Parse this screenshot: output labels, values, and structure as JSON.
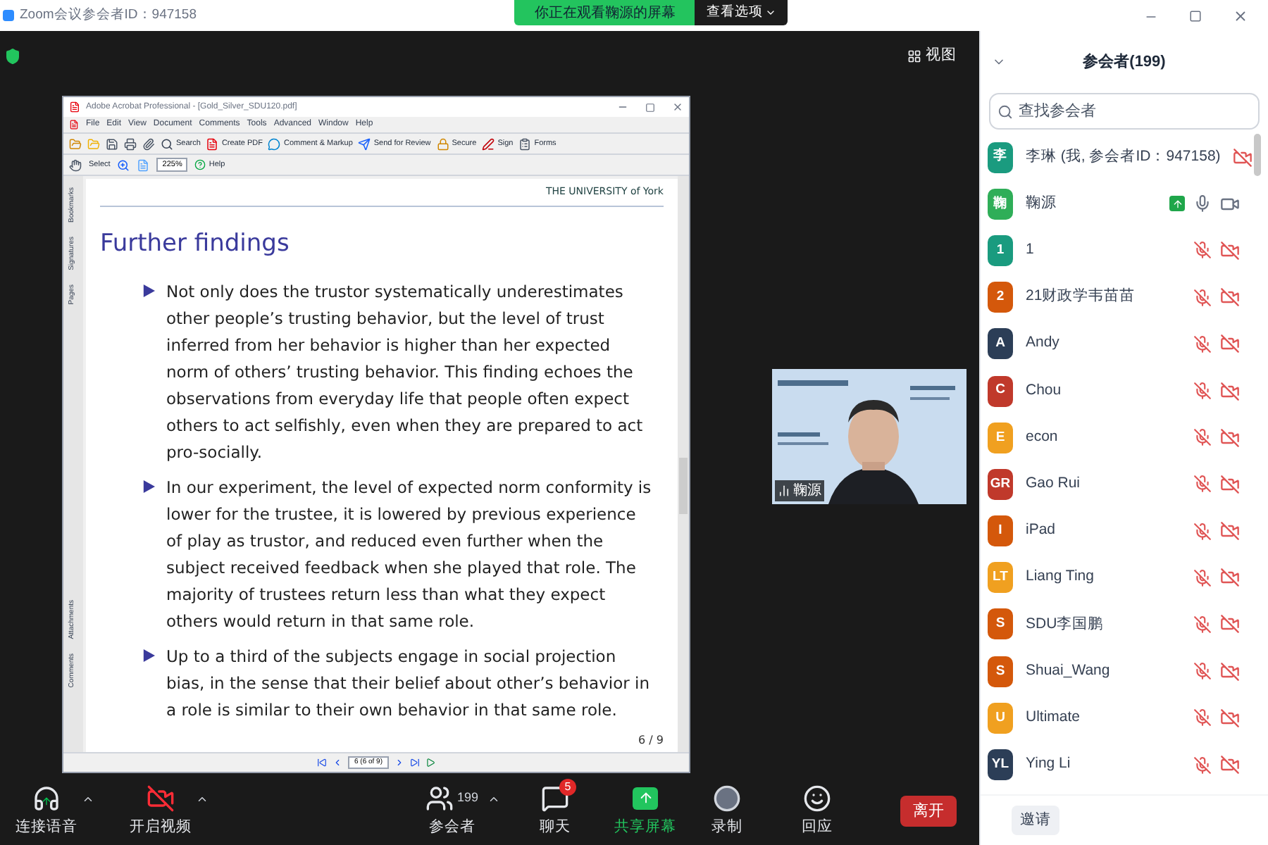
{
  "window": {
    "title": "Zoom会议参会者ID：947158"
  },
  "share_banner": {
    "text": "你正在观看鞠源的屏幕",
    "options": "查看选项"
  },
  "view_button": "视图",
  "acrobat": {
    "title": "Adobe Acrobat Professional - [Gold_Silver_SDU120.pdf]",
    "menu": [
      "File",
      "Edit",
      "View",
      "Document",
      "Comments",
      "Tools",
      "Advanced",
      "Window",
      "Help"
    ],
    "toolbar_1": [
      {
        "kind": "search",
        "label": "Search"
      },
      {
        "kind": "pdf",
        "label": "Create PDF"
      },
      {
        "kind": "comment",
        "label": "Comment & Markup"
      },
      {
        "kind": "review",
        "label": "Send for Review"
      },
      {
        "kind": "lock",
        "label": "Secure"
      },
      {
        "kind": "pen",
        "label": "Sign"
      },
      {
        "kind": "form",
        "label": "Forms"
      }
    ],
    "select_tool": "Select",
    "zoom": "225%",
    "help": "Help",
    "nav_tabs": [
      "Bookmarks",
      "Signatures",
      "Pages",
      "Attachments",
      "Comments"
    ],
    "page_field": "6 (6 of 9)"
  },
  "slide": {
    "header": "THE UNIVERSITY of York",
    "title": "Further findings",
    "bullets": [
      "Not only does the trustor systematically underestimates other people’s trusting behavior, but the level of trust inferred from her behavior is higher than her expected norm of others’ trusting behavior.  This finding echoes the observations from everyday life that people often expect others to act selfishly, even when they are prepared to act pro-socially.",
      "In our experiment, the level of expected norm conformity is lower for the trustee, it is lowered by previous experience of play as trustor, and reduced even further when the subject received feedback when she played that role.  The majority of trustees return less than what they expect others would return in that same role.",
      "Up to a third of the subjects engage in social projection bias, in the sense that their belief about other’s behavior in a role is similar to their own behavior in that same role."
    ],
    "page": "6 / 9"
  },
  "video_tile": {
    "kind": "picture",
    "name": "鞠源"
  },
  "toolbar": [
    {
      "kind": "audio",
      "label": "连接语音"
    },
    {
      "kind": "video",
      "label": "开启视频"
    },
    {
      "kind": "participants",
      "label": "参会者",
      "count": "199"
    },
    {
      "kind": "chat",
      "label": "聊天",
      "badge": "5"
    },
    {
      "kind": "share",
      "label": "共享屏幕"
    },
    {
      "kind": "record",
      "label": "录制"
    },
    {
      "kind": "reactions",
      "label": "回应"
    }
  ],
  "leave_button": "离开",
  "panel": {
    "title": "参会者(199)",
    "search": {
      "placeholder": "查找参会者"
    },
    "participants": [
      {
        "initial": "李",
        "name": "李琳 (我, 参会者ID：947158)",
        "color": "#1a9b7f",
        "audio_joined": false,
        "video_on": false,
        "sharing": false
      },
      {
        "initial": "鞠",
        "name": "鞠源",
        "color": "#2fae58",
        "audio_joined": true,
        "mic_muted": false,
        "video_on": true,
        "sharing": true
      },
      {
        "initial": "1",
        "name": "1",
        "color": "#1a9b7f",
        "audio_joined": true,
        "mic_muted": true,
        "video_on": false,
        "sharing": false
      },
      {
        "initial": "2",
        "name": "21财政学韦苗苗",
        "color": "#d4580b",
        "audio_joined": true,
        "mic_muted": true,
        "video_on": false,
        "sharing": false
      },
      {
        "initial": "A",
        "name": "Andy",
        "color": "#2c3e57",
        "audio_joined": true,
        "mic_muted": true,
        "video_on": false,
        "sharing": false
      },
      {
        "initial": "C",
        "name": "Chou",
        "color": "#c0392b",
        "audio_joined": true,
        "mic_muted": true,
        "video_on": false,
        "sharing": false
      },
      {
        "initial": "E",
        "name": "econ",
        "color": "#f0a020",
        "audio_joined": true,
        "mic_muted": true,
        "video_on": false,
        "sharing": false
      },
      {
        "initial": "GR",
        "name": "Gao Rui",
        "color": "#c0392b",
        "audio_joined": true,
        "mic_muted": true,
        "video_on": false,
        "sharing": false
      },
      {
        "initial": "I",
        "name": "iPad",
        "color": "#d4580b",
        "audio_joined": true,
        "mic_muted": true,
        "video_on": false,
        "sharing": false
      },
      {
        "initial": "LT",
        "name": "Liang Ting",
        "color": "#f0a020",
        "audio_joined": true,
        "mic_muted": true,
        "video_on": false,
        "sharing": false
      },
      {
        "initial": "S",
        "name": "SDU李国鹏",
        "color": "#d4580b",
        "audio_joined": true,
        "mic_muted": true,
        "video_on": false,
        "sharing": false
      },
      {
        "initial": "S",
        "name": "Shuai_Wang",
        "color": "#d4580b",
        "audio_joined": true,
        "mic_muted": true,
        "video_on": false,
        "sharing": false
      },
      {
        "initial": "U",
        "name": "Ultimate",
        "color": "#f0a020",
        "audio_joined": true,
        "mic_muted": true,
        "video_on": false,
        "sharing": false
      },
      {
        "initial": "YL",
        "name": "Ying Li",
        "color": "#2c3e57",
        "audio_joined": true,
        "mic_muted": true,
        "video_on": false,
        "sharing": false
      }
    ],
    "invite_button": "邀请"
  }
}
